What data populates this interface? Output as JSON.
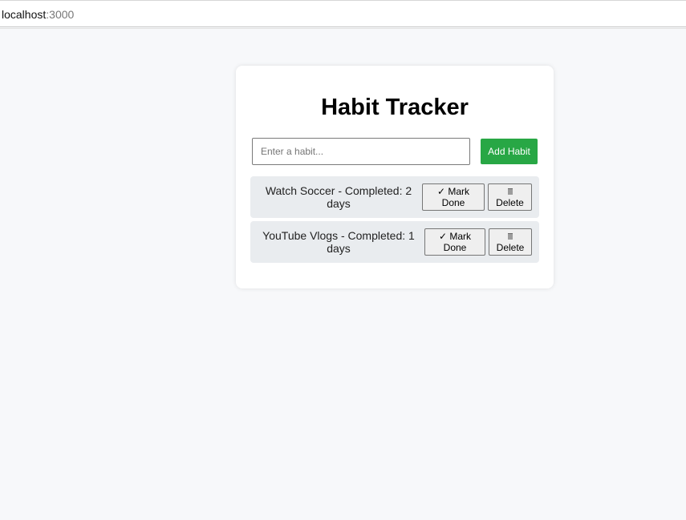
{
  "browser": {
    "url_host": "localhost",
    "url_port": ":3000"
  },
  "app": {
    "title": "Habit Tracker",
    "input_placeholder": "Enter a habit...",
    "add_button_label": "Add Habit",
    "accent_color": "#28a745"
  },
  "habits": [
    {
      "text": "Watch Soccer - Completed: 2 days",
      "mark_done_line1": "✓ Mark",
      "mark_done_line2": "Done",
      "delete_icon": "trash-icon",
      "delete_label": "Delete"
    },
    {
      "text": "YouTube Vlogs - Completed: 1 days",
      "mark_done_line1": "✓ Mark",
      "mark_done_line2": "Done",
      "delete_icon": "trash-icon",
      "delete_label": "Delete"
    }
  ]
}
